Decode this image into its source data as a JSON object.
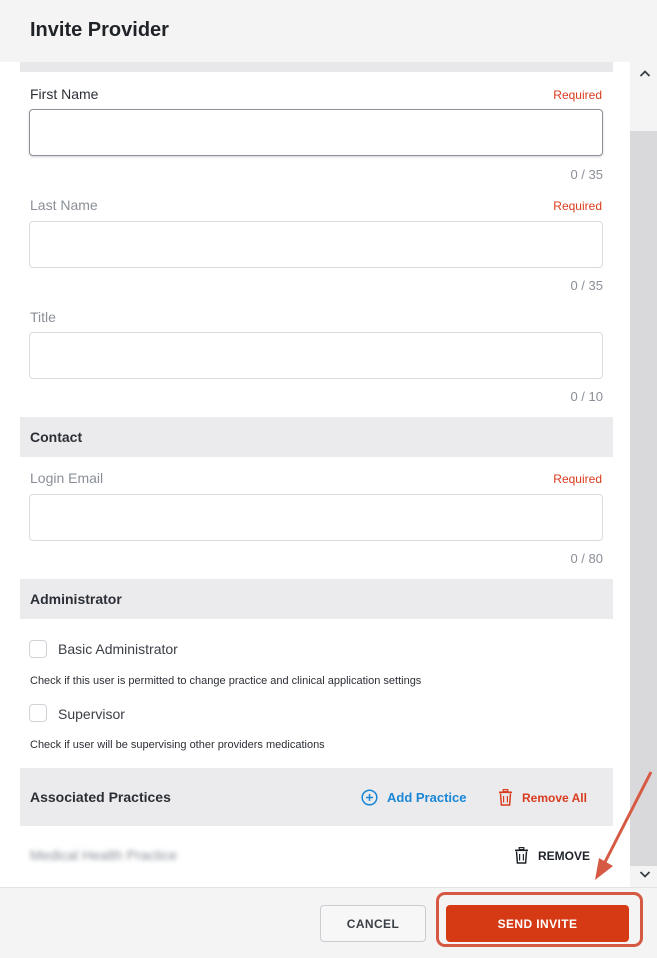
{
  "dialog": {
    "title": "Invite Provider"
  },
  "fields": {
    "first_name": {
      "label": "First Name",
      "required": "Required",
      "value": "",
      "counter": "0 / 35"
    },
    "last_name": {
      "label": "Last Name",
      "required": "Required",
      "value": "",
      "counter": "0 / 35"
    },
    "title": {
      "label": "Title",
      "value": "",
      "counter": "0 / 10"
    }
  },
  "contact": {
    "section_title": "Contact",
    "login_email": {
      "label": "Login Email",
      "required": "Required",
      "value": "",
      "counter": "0 / 80"
    }
  },
  "administrator": {
    "section_title": "Administrator",
    "basic_admin": {
      "label": "Basic Administrator",
      "checked": false,
      "help": "Check if this user is permitted to change practice and clinical application settings"
    },
    "supervisor": {
      "label": "Supervisor",
      "checked": false,
      "help": "Check if user will be supervising other providers medications"
    }
  },
  "associated_practices": {
    "section_title": "Associated Practices",
    "add_label": "Add Practice",
    "remove_all_label": "Remove All",
    "items": [
      {
        "name": "Medical Health Practice",
        "remove_label": "REMOVE"
      }
    ]
  },
  "footer": {
    "cancel_label": "CANCEL",
    "send_label": "SEND INVITE"
  },
  "colors": {
    "accent": "#d63a14",
    "link": "#1a87d6",
    "required": "#d93b1d"
  },
  "icons": {
    "add": "plus-circle-icon",
    "remove_all": "trash-icon",
    "remove": "trash-icon",
    "scroll_up": "chevron-up-icon",
    "scroll_down": "chevron-down-icon"
  }
}
